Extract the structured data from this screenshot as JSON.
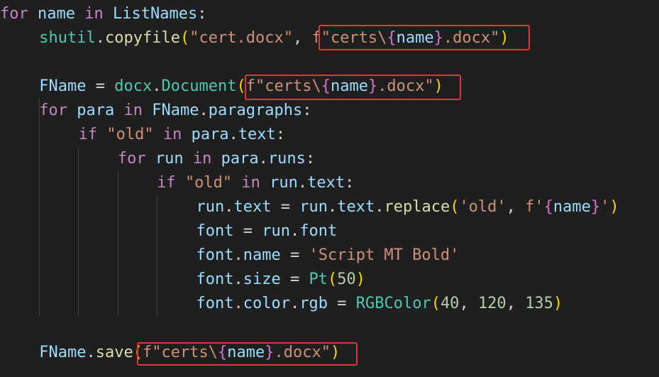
{
  "editor": {
    "lines": [
      {
        "indent": 0,
        "tokens": [
          {
            "t": "for",
            "c": "kw"
          },
          {
            "t": " ",
            "c": "plain"
          },
          {
            "t": "name",
            "c": "var"
          },
          {
            "t": " ",
            "c": "plain"
          },
          {
            "t": "in",
            "c": "kw"
          },
          {
            "t": " ",
            "c": "plain"
          },
          {
            "t": "ListNames",
            "c": "var"
          },
          {
            "t": ":",
            "c": "op"
          }
        ]
      },
      {
        "indent": 1,
        "tokens": [
          {
            "t": "shutil",
            "c": "cls"
          },
          {
            "t": ".",
            "c": "op"
          },
          {
            "t": "copyfile",
            "c": "fn"
          },
          {
            "t": "(",
            "c": "br1"
          },
          {
            "t": "\"cert.docx\"",
            "c": "str"
          },
          {
            "t": ", ",
            "c": "op"
          },
          {
            "t": "f\"certs\\",
            "c": "str"
          },
          {
            "t": "{",
            "c": "br2"
          },
          {
            "t": "name",
            "c": "var"
          },
          {
            "t": "}",
            "c": "br2"
          },
          {
            "t": ".docx\"",
            "c": "str"
          },
          {
            "t": ")",
            "c": "br1"
          }
        ]
      },
      {
        "indent": 0,
        "tokens": []
      },
      {
        "indent": 1,
        "tokens": [
          {
            "t": "FName",
            "c": "var"
          },
          {
            "t": " = ",
            "c": "op"
          },
          {
            "t": "docx",
            "c": "cls"
          },
          {
            "t": ".",
            "c": "op"
          },
          {
            "t": "Document",
            "c": "cls"
          },
          {
            "t": "(",
            "c": "br1"
          },
          {
            "t": "f\"certs\\",
            "c": "str"
          },
          {
            "t": "{",
            "c": "br2"
          },
          {
            "t": "name",
            "c": "var"
          },
          {
            "t": "}",
            "c": "br2"
          },
          {
            "t": ".docx\"",
            "c": "str"
          },
          {
            "t": ")",
            "c": "br1"
          }
        ]
      },
      {
        "indent": 1,
        "tokens": [
          {
            "t": "for",
            "c": "kw"
          },
          {
            "t": " ",
            "c": "plain"
          },
          {
            "t": "para",
            "c": "var"
          },
          {
            "t": " ",
            "c": "plain"
          },
          {
            "t": "in",
            "c": "kw"
          },
          {
            "t": " ",
            "c": "plain"
          },
          {
            "t": "FName",
            "c": "var"
          },
          {
            "t": ".",
            "c": "op"
          },
          {
            "t": "paragraphs",
            "c": "var"
          },
          {
            "t": ":",
            "c": "op"
          }
        ]
      },
      {
        "indent": 2,
        "tokens": [
          {
            "t": "if",
            "c": "kw"
          },
          {
            "t": " ",
            "c": "plain"
          },
          {
            "t": "\"old\"",
            "c": "str"
          },
          {
            "t": " ",
            "c": "plain"
          },
          {
            "t": "in",
            "c": "kw"
          },
          {
            "t": " ",
            "c": "plain"
          },
          {
            "t": "para",
            "c": "var"
          },
          {
            "t": ".",
            "c": "op"
          },
          {
            "t": "text",
            "c": "var"
          },
          {
            "t": ":",
            "c": "op"
          }
        ]
      },
      {
        "indent": 3,
        "tokens": [
          {
            "t": "for",
            "c": "kw"
          },
          {
            "t": " ",
            "c": "plain"
          },
          {
            "t": "run",
            "c": "var"
          },
          {
            "t": " ",
            "c": "plain"
          },
          {
            "t": "in",
            "c": "kw"
          },
          {
            "t": " ",
            "c": "plain"
          },
          {
            "t": "para",
            "c": "var"
          },
          {
            "t": ".",
            "c": "op"
          },
          {
            "t": "runs",
            "c": "var"
          },
          {
            "t": ":",
            "c": "op"
          }
        ]
      },
      {
        "indent": 4,
        "tokens": [
          {
            "t": "if",
            "c": "kw"
          },
          {
            "t": " ",
            "c": "plain"
          },
          {
            "t": "\"old\"",
            "c": "str"
          },
          {
            "t": " ",
            "c": "plain"
          },
          {
            "t": "in",
            "c": "kw"
          },
          {
            "t": " ",
            "c": "plain"
          },
          {
            "t": "run",
            "c": "var"
          },
          {
            "t": ".",
            "c": "op"
          },
          {
            "t": "text",
            "c": "var"
          },
          {
            "t": ":",
            "c": "op"
          }
        ]
      },
      {
        "indent": 5,
        "tokens": [
          {
            "t": "run",
            "c": "var"
          },
          {
            "t": ".",
            "c": "op"
          },
          {
            "t": "text",
            "c": "var"
          },
          {
            "t": " = ",
            "c": "op"
          },
          {
            "t": "run",
            "c": "var"
          },
          {
            "t": ".",
            "c": "op"
          },
          {
            "t": "text",
            "c": "var"
          },
          {
            "t": ".",
            "c": "op"
          },
          {
            "t": "replace",
            "c": "fn"
          },
          {
            "t": "(",
            "c": "br1"
          },
          {
            "t": "'old'",
            "c": "str"
          },
          {
            "t": ", ",
            "c": "op"
          },
          {
            "t": "f'",
            "c": "str"
          },
          {
            "t": "{",
            "c": "br2"
          },
          {
            "t": "name",
            "c": "var"
          },
          {
            "t": "}",
            "c": "br2"
          },
          {
            "t": "'",
            "c": "str"
          },
          {
            "t": ")",
            "c": "br1"
          }
        ]
      },
      {
        "indent": 5,
        "tokens": [
          {
            "t": "font",
            "c": "var"
          },
          {
            "t": " = ",
            "c": "op"
          },
          {
            "t": "run",
            "c": "var"
          },
          {
            "t": ".",
            "c": "op"
          },
          {
            "t": "font",
            "c": "var"
          }
        ]
      },
      {
        "indent": 5,
        "tokens": [
          {
            "t": "font",
            "c": "var"
          },
          {
            "t": ".",
            "c": "op"
          },
          {
            "t": "name",
            "c": "var"
          },
          {
            "t": " = ",
            "c": "op"
          },
          {
            "t": "'Script MT Bold'",
            "c": "str"
          }
        ]
      },
      {
        "indent": 5,
        "tokens": [
          {
            "t": "font",
            "c": "var"
          },
          {
            "t": ".",
            "c": "op"
          },
          {
            "t": "size",
            "c": "var"
          },
          {
            "t": " = ",
            "c": "op"
          },
          {
            "t": "Pt",
            "c": "cls"
          },
          {
            "t": "(",
            "c": "br1"
          },
          {
            "t": "50",
            "c": "num"
          },
          {
            "t": ")",
            "c": "br1"
          }
        ]
      },
      {
        "indent": 5,
        "tokens": [
          {
            "t": "font",
            "c": "var"
          },
          {
            "t": ".",
            "c": "op"
          },
          {
            "t": "color",
            "c": "var"
          },
          {
            "t": ".",
            "c": "op"
          },
          {
            "t": "rgb",
            "c": "var"
          },
          {
            "t": " = ",
            "c": "op"
          },
          {
            "t": "RGBColor",
            "c": "cls"
          },
          {
            "t": "(",
            "c": "br1"
          },
          {
            "t": "40",
            "c": "num"
          },
          {
            "t": ", ",
            "c": "op"
          },
          {
            "t": "120",
            "c": "num"
          },
          {
            "t": ", ",
            "c": "op"
          },
          {
            "t": "135",
            "c": "num"
          },
          {
            "t": ")",
            "c": "br1"
          }
        ]
      },
      {
        "indent": 0,
        "tokens": []
      },
      {
        "indent": 1,
        "tokens": [
          {
            "t": "FName",
            "c": "var"
          },
          {
            "t": ".",
            "c": "op"
          },
          {
            "t": "save",
            "c": "fn"
          },
          {
            "t": "(",
            "c": "br1"
          },
          {
            "t": "f\"certs\\",
            "c": "str"
          },
          {
            "t": "{",
            "c": "br2"
          },
          {
            "t": "name",
            "c": "var"
          },
          {
            "t": "}",
            "c": "br2"
          },
          {
            "t": ".docx\"",
            "c": "str"
          },
          {
            "t": ")",
            "c": "br1"
          }
        ]
      }
    ]
  },
  "colors": {
    "background": "#1f1f1f",
    "highlight_border": "#e5313d",
    "indent_guide": "#404040"
  }
}
